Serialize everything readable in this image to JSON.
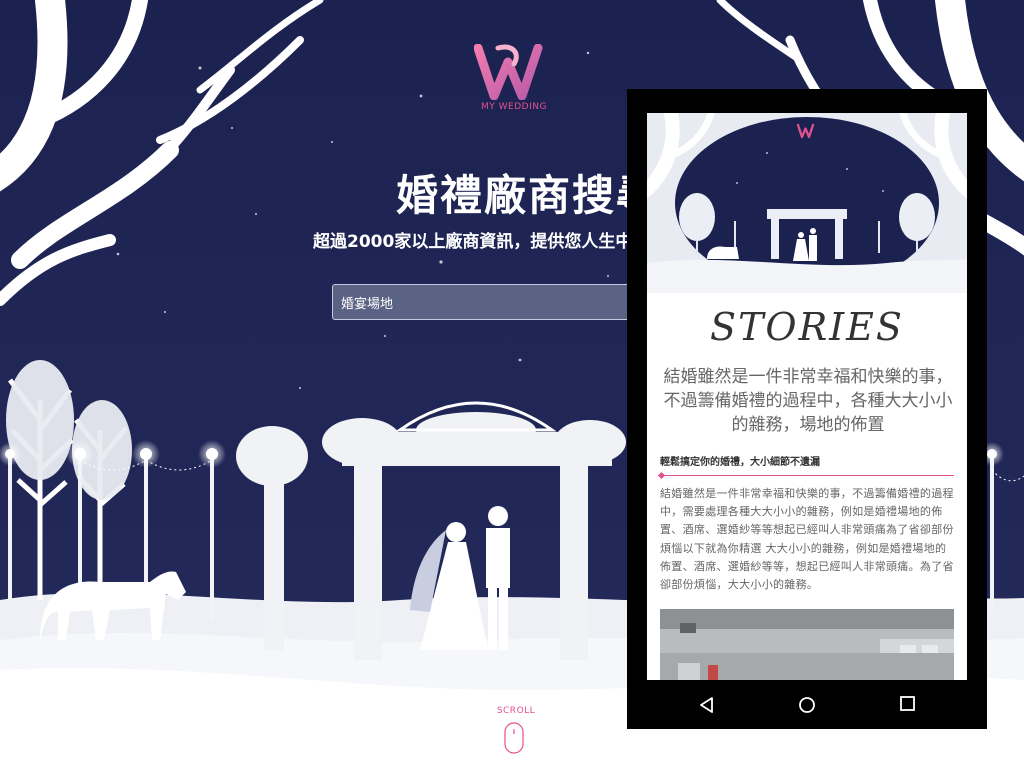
{
  "brand": {
    "name": "MY WEDDING",
    "accent": "#e5518f",
    "navy": "#1b2150"
  },
  "hero": {
    "title": "婚禮廠商搜尋",
    "subtitle": "超過2000家以上廠商資訊，提供您人生中",
    "search": {
      "value": "婚宴場地",
      "placeholder": ""
    }
  },
  "scroll": {
    "label": "SCROLL",
    "icon": "mouse-icon"
  },
  "phone": {
    "logo_icon": "w-logo-icon",
    "stories_title": "STORIES",
    "lead": "結婚雖然是一件非常幸福和快樂的事，不過籌備婚禮的過程中，各種大大小小的雜務，場地的佈置",
    "section_heading": "輕鬆搞定你的婚禮，大小細節不遺漏",
    "body": "結婚雖然是一件非常幸福和快樂的事，不過籌備婚禮的過程中，需要處理各種大大小小的雜務，例如是婚禮場地的佈置、酒席、選婚紗等等想起已經叫人非常頭痛為了省卻部份煩惱以下就為你精選 大大小小的雜務，例如是婚禮場地的佈置、酒席、選婚紗等等，想起已經叫人非常頭痛。為了省卻部份煩惱，大大小小的雜務。",
    "nav": {
      "back_icon": "back-triangle-icon",
      "home_icon": "home-circle-icon",
      "recent_icon": "recent-square-icon"
    }
  }
}
